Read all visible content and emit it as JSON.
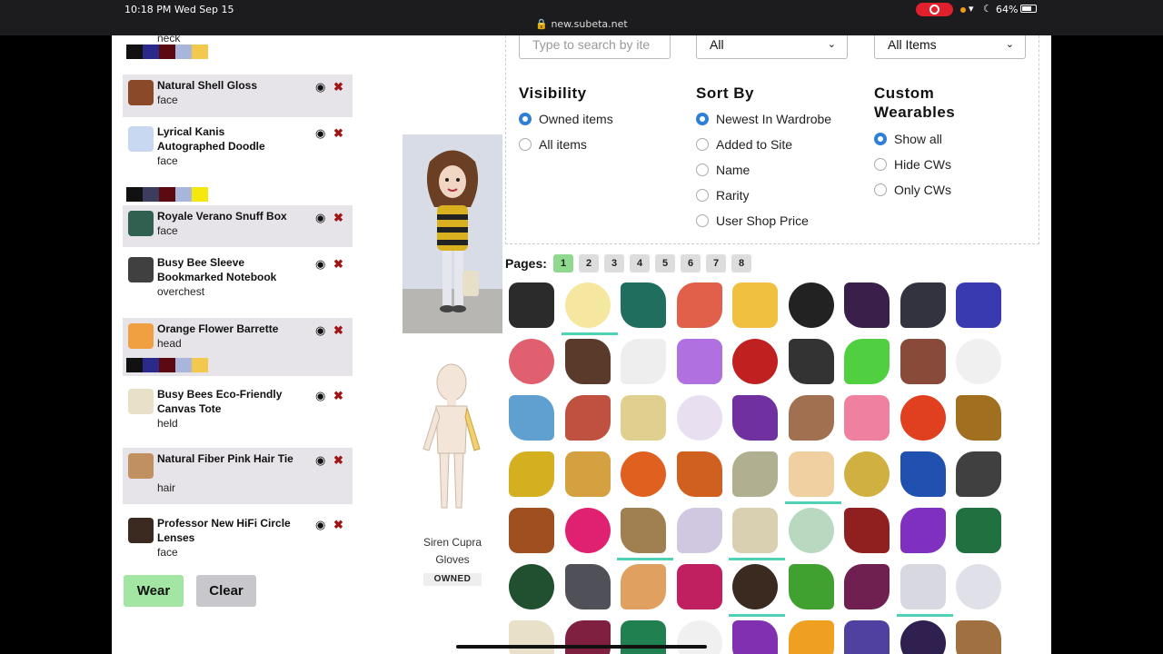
{
  "status_bar": {
    "time": "10:18 PM   Wed Sep 15",
    "url": "🔒 new.subeta.net",
    "battery": "64%"
  },
  "worn_items": [
    {
      "name": "",
      "slot": "neck",
      "shaded": false,
      "swatches": [
        "#111111",
        "#2a2a8a",
        "#5c0a12",
        "#a8b6dc",
        "#f2c94c"
      ]
    },
    {
      "name": "Natural Shell Gloss",
      "slot": "face",
      "shaded": true,
      "swatches": []
    },
    {
      "name": "Lyrical Kanis Autographed Doodle",
      "slot": "face",
      "shaded": false,
      "swatches": [
        "#111111",
        "#3c3c5c",
        "#5c0a12",
        "#a8b6dc",
        "#f5e80c"
      ]
    },
    {
      "name": "Royale Verano Snuff Box",
      "slot": "face",
      "shaded": true,
      "swatches": []
    },
    {
      "name": "Busy Bee Sleeve Bookmarked Notebook",
      "slot": "overchest",
      "shaded": false,
      "swatches": []
    },
    {
      "name": "Orange Flower Barrette",
      "slot": "head",
      "shaded": true,
      "swatches": [
        "#111111",
        "#2a2a8a",
        "#5c0a12",
        "#a8b6dc",
        "#f2c94c"
      ]
    },
    {
      "name": "Busy Bees Eco-Friendly Canvas Tote",
      "slot": "held",
      "shaded": false,
      "swatches": []
    },
    {
      "name": "Natural Fiber Pink Hair Tie",
      "slot": "hair",
      "shaded": true,
      "swatches": []
    },
    {
      "name": "Professor New HiFi Circle Lenses",
      "slot": "face",
      "shaded": false,
      "swatches": []
    }
  ],
  "buttons": {
    "wear": "Wear",
    "clear": "Clear"
  },
  "preview": {
    "name": "Siren Cupra Gloves",
    "owned_badge": "OWNED"
  },
  "search": {
    "placeholder": "Type to search by ite"
  },
  "selects": {
    "category": "All",
    "type": "All Items"
  },
  "visibility": {
    "heading": "Visibility",
    "options": [
      {
        "label": "Owned items",
        "selected": true
      },
      {
        "label": "All items",
        "selected": false
      }
    ]
  },
  "sort_by": {
    "heading": "Sort By",
    "options": [
      {
        "label": "Newest In Wardrobe",
        "selected": true
      },
      {
        "label": "Added to Site",
        "selected": false
      },
      {
        "label": "Name",
        "selected": false
      },
      {
        "label": "Rarity",
        "selected": false
      },
      {
        "label": "User Shop Price",
        "selected": false
      }
    ]
  },
  "custom_wearables": {
    "heading": "Custom Wearables",
    "options": [
      {
        "label": "Show all",
        "selected": true
      },
      {
        "label": "Hide CWs",
        "selected": false
      },
      {
        "label": "Only CWs",
        "selected": false
      }
    ]
  },
  "pagination": {
    "label": "Pages:",
    "pages": [
      "1",
      "2",
      "3",
      "4",
      "5",
      "6",
      "7",
      "8"
    ],
    "active": "1"
  },
  "item_grid": [
    {
      "icon": "boots-icon",
      "color": "#2b2b2b",
      "worn": false
    },
    {
      "icon": "scarf-icon",
      "color": "#f5e6a0",
      "worn": true
    },
    {
      "icon": "shawl-icon",
      "color": "#1f6e5e",
      "worn": false
    },
    {
      "icon": "carrot-icon",
      "color": "#e0604a",
      "worn": false
    },
    {
      "icon": "crayon-icon",
      "color": "#f0c040",
      "worn": false
    },
    {
      "icon": "helmet-icon",
      "color": "#222222",
      "worn": false
    },
    {
      "icon": "purple-boots-icon",
      "color": "#3a1f4a",
      "worn": false
    },
    {
      "icon": "hat-icon",
      "color": "#333340",
      "worn": false
    },
    {
      "icon": "shirt-icon",
      "color": "#3a3ab0",
      "worn": false
    },
    {
      "icon": "pacifier-icon",
      "color": "#e06070",
      "worn": false
    },
    {
      "icon": "stockings-icon",
      "color": "#5a3a2a",
      "worn": false
    },
    {
      "icon": "collar-icon",
      "color": "#eeeeee",
      "worn": false
    },
    {
      "icon": "note-icon",
      "color": "#b070e0",
      "worn": false
    },
    {
      "icon": "mittens-icon",
      "color": "#c02020",
      "worn": false
    },
    {
      "icon": "bag-icon",
      "color": "#333333",
      "worn": false
    },
    {
      "icon": "sneakers-icon",
      "color": "#50d040",
      "worn": false
    },
    {
      "icon": "sticks-icon",
      "color": "#8a4a3a",
      "worn": false
    },
    {
      "icon": "snowman-icon",
      "color": "#f0f0f0",
      "worn": false
    },
    {
      "icon": "purse-icon",
      "color": "#60a0d0",
      "worn": false
    },
    {
      "icon": "brushes-icon",
      "color": "#c05040",
      "worn": false
    },
    {
      "icon": "map-icon",
      "color": "#e0d090",
      "worn": false
    },
    {
      "icon": "dress-icon",
      "color": "#e8e0f0",
      "worn": false
    },
    {
      "icon": "cloud-icon",
      "color": "#7030a0",
      "worn": false
    },
    {
      "icon": "pinecones-icon",
      "color": "#a07050",
      "worn": false
    },
    {
      "icon": "hearts-icon",
      "color": "#f080a0",
      "worn": false
    },
    {
      "icon": "pumpkin-icon",
      "color": "#e04020",
      "worn": false
    },
    {
      "icon": "garland-icon",
      "color": "#a07020",
      "worn": false
    },
    {
      "icon": "striped-shirt-icon",
      "color": "#d4b020",
      "worn": false
    },
    {
      "icon": "painting-icon",
      "color": "#d4a040",
      "worn": false
    },
    {
      "icon": "sweater-icon",
      "color": "#e06020",
      "worn": false
    },
    {
      "icon": "pumpkins-icon",
      "color": "#d06020",
      "worn": false
    },
    {
      "icon": "skull-icon",
      "color": "#b0b090",
      "worn": false
    },
    {
      "icon": "top-icon",
      "color": "#f0d0a0",
      "worn": true
    },
    {
      "icon": "wreath-icon",
      "color": "#d0b040",
      "worn": false
    },
    {
      "icon": "skirt-icon",
      "color": "#2050b0",
      "worn": false
    },
    {
      "icon": "bat-icon",
      "color": "#404040",
      "worn": false
    },
    {
      "icon": "striped-scarf-icon",
      "color": "#a05020",
      "worn": false
    },
    {
      "icon": "basket-icon",
      "color": "#e02070",
      "worn": false
    },
    {
      "icon": "satchel-icon",
      "color": "#a08050",
      "worn": true
    },
    {
      "icon": "ghost-icon",
      "color": "#d0c8e0",
      "worn": false
    },
    {
      "icon": "tote-icon",
      "color": "#d8d0b0",
      "worn": true
    },
    {
      "icon": "ball-icon",
      "color": "#b8d8c0",
      "worn": false
    },
    {
      "icon": "creature-icon",
      "color": "#902020",
      "worn": false
    },
    {
      "icon": "ribbon-icon",
      "color": "#8030c0",
      "worn": false
    },
    {
      "icon": "bandana-icon",
      "color": "#207040",
      "worn": false
    },
    {
      "icon": "beret-icon",
      "color": "#205030",
      "worn": false
    },
    {
      "icon": "robe-icon",
      "color": "#505058",
      "worn": false
    },
    {
      "icon": "sparkle-shirt-icon",
      "color": "#e0a060",
      "worn": false
    },
    {
      "icon": "lipstick-icon",
      "color": "#c02060",
      "worn": false
    },
    {
      "icon": "hair-icon",
      "color": "#3a2a20",
      "worn": true
    },
    {
      "icon": "frog-hat-icon",
      "color": "#40a030",
      "worn": false
    },
    {
      "icon": "cape-icon",
      "color": "#702050",
      "worn": false
    },
    {
      "icon": "thought-icon",
      "color": "#d8d8e0",
      "worn": true
    },
    {
      "icon": "wings-icon",
      "color": "#e0e0e8",
      "worn": false
    },
    {
      "icon": "jacket-icon",
      "color": "#e8e0c8",
      "worn": false
    },
    {
      "icon": "flowers-icon",
      "color": "#802040",
      "worn": false
    },
    {
      "icon": "green-sweater-icon",
      "color": "#208050",
      "worn": false
    },
    {
      "icon": "chef-hat-icon",
      "color": "#f0f0f0",
      "worn": false
    },
    {
      "icon": "mushroom-icon",
      "color": "#8030b0",
      "worn": false
    },
    {
      "icon": "star-icon",
      "color": "#f0a020",
      "worn": false
    },
    {
      "icon": "purple-hat-icon",
      "color": "#5040a0",
      "worn": false
    },
    {
      "icon": "dark-hair-icon",
      "color": "#302050",
      "worn": false
    },
    {
      "icon": "jar-icon",
      "color": "#a07040",
      "worn": false
    }
  ]
}
